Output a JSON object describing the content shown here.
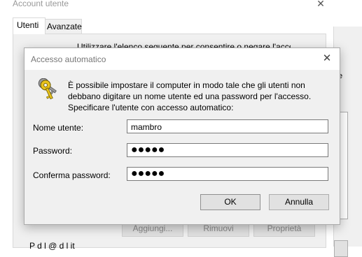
{
  "background_window": {
    "title": "Account utente",
    "close_glyph": "✕",
    "tabs": [
      {
        "label": "Utenti",
        "active": true
      },
      {
        "label": "Avanzate",
        "active": false
      }
    ],
    "description_partial": "Utilizzare l'elenco seguente per consentire o negare l'accesso al",
    "right_edge_char": "e",
    "buttons": {
      "add": "Aggiungi...",
      "remove": "Rimuovi",
      "properties": "Proprietà"
    },
    "bottom_text_partial": "P         d l             @              d       l   it"
  },
  "dialog": {
    "title": "Accesso automatico",
    "close_glyph": "✕",
    "icon": "keys-icon",
    "description": [
      "È possibile impostare il computer in modo tale che gli utenti non",
      "debbano digitare un nome utente ed una password per l'accesso.",
      "Specificare l'utente con accesso automatico:"
    ],
    "fields": {
      "username_label": "Nome utente:",
      "username_value": "mambro",
      "password_label": "Password:",
      "password_value": "●●●●●",
      "confirm_label": "Conferma password:",
      "confirm_value": "●●●●●"
    },
    "buttons": {
      "ok": "OK",
      "cancel": "Annulla"
    }
  },
  "colors": {
    "dialog_bg": "#f0f0f0",
    "titlebar_bg": "#ffffff",
    "disabled_text": "#8a8a8a",
    "field_border": "#7a7a7a"
  }
}
